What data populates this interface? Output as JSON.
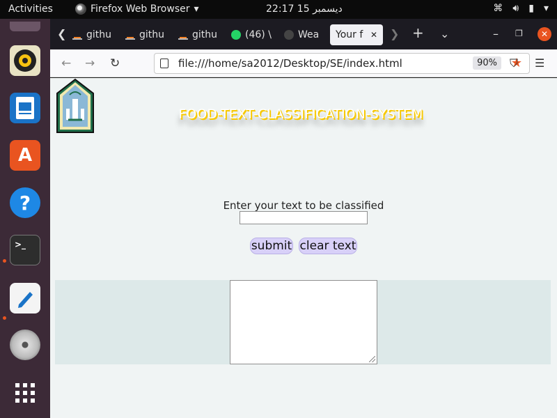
{
  "topbar": {
    "activities": "Activities",
    "app_name": "Firefox Web Browser",
    "clock": "22:17  15 ديسمبر"
  },
  "dock": {
    "items": [
      "rhythmbox",
      "writer",
      "software",
      "help",
      "terminal",
      "text-editor",
      "dvd",
      "app-grid"
    ]
  },
  "tabs": [
    {
      "label": "githu",
      "icon": "stackoverflow-icon"
    },
    {
      "label": "githu",
      "icon": "stackoverflow-icon"
    },
    {
      "label": "githu",
      "icon": "stackoverflow-icon"
    },
    {
      "label": "(46) \\",
      "icon": "whatsapp-icon"
    },
    {
      "label": "Wea",
      "icon": "github-icon"
    },
    {
      "label": "Your f",
      "icon": "",
      "active": true
    }
  ],
  "navbar": {
    "url": "file:///home/sa2012/Desktop/SE/index.html",
    "zoom": "90%"
  },
  "page": {
    "title": "FOOD-TEXT-CLASSIFICATION-SYSTEM",
    "prompt": "Enter your text to be classified",
    "input_value": "",
    "submit_label": "submit",
    "clear_label": "clear text",
    "result_value": ""
  },
  "colors": {
    "accent": "#e95420",
    "title_shadow": "#f7c800",
    "button_bg": "#d8d0f8",
    "page_bg": "#f0f4f4"
  }
}
